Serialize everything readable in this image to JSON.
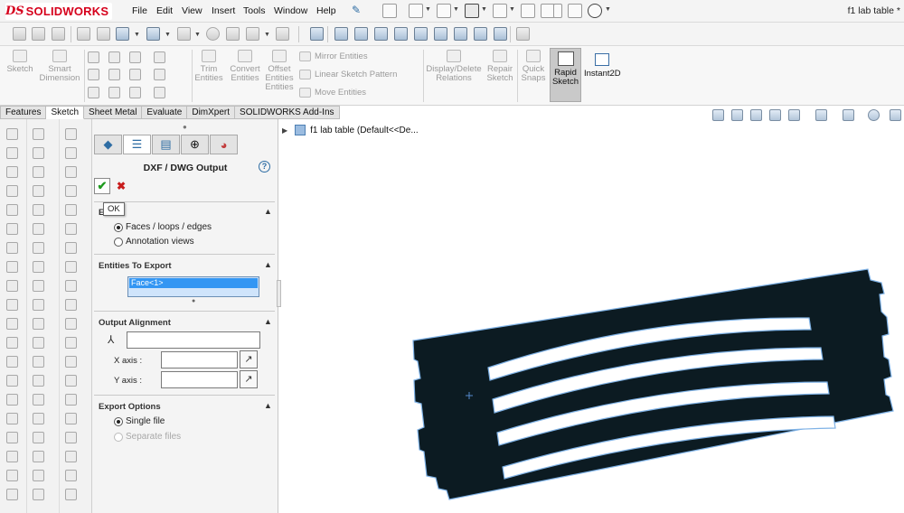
{
  "app": {
    "logo_mark": "DS",
    "logo_text": "SOLIDWORKS",
    "document_title": "f1 lab table *"
  },
  "menu": {
    "items": [
      "File",
      "Edit",
      "View",
      "Insert",
      "Tools",
      "Window",
      "Help"
    ]
  },
  "tabs": {
    "items": [
      "Features",
      "Sketch",
      "Sheet Metal",
      "Evaluate",
      "DimXpert",
      "SOLIDWORKS Add-Ins"
    ],
    "active": "Sketch"
  },
  "command_manager": {
    "sketch": "Sketch",
    "smart_dimension_1": "Smart",
    "smart_dimension_2": "Dimension",
    "trim_1": "Trim",
    "trim_2": "Entities",
    "convert_1": "Convert",
    "convert_2": "Entities",
    "offset_1": "Offset",
    "offset_2": "Entities",
    "mirror": "Mirror Entities",
    "linear_pattern": "Linear Sketch Pattern",
    "move": "Move Entities",
    "display_delete_1": "Display/Delete",
    "display_delete_2": "Relations",
    "repair_1": "Repair",
    "repair_2": "Sketch",
    "quick_snaps_1": "Quick",
    "quick_snaps_2": "Snaps",
    "rapid_sketch_1": "Rapid",
    "rapid_sketch_2": "Sketch",
    "instant2d": "Instant2D"
  },
  "property_manager": {
    "title": "DXF / DWG Output",
    "help": "?",
    "ok_glyph": "✔",
    "cancel_glyph": "✖",
    "ok_tooltip": "OK",
    "export_section_head": "E",
    "export_options": [
      {
        "label": "Faces / loops / edges",
        "checked": true
      },
      {
        "label": "Annotation views",
        "checked": false
      }
    ],
    "entities_section_head": "Entities To Export",
    "entities_selected": "Face<1>",
    "alignment_section_head": "Output Alignment",
    "x_axis_label": "X axis :",
    "y_axis_label": "Y axis :",
    "export_options_head": "Export Options",
    "file_options": [
      {
        "label": "Single file",
        "checked": true,
        "enabled": true
      },
      {
        "label": "Separate files",
        "checked": false,
        "enabled": false
      }
    ]
  },
  "graphics": {
    "tree_root": "f1 lab table  (Default<<De...",
    "part_fill": "#0c1b22",
    "part_outline": "#7fb2e6",
    "slot_fill": "#ffffff"
  },
  "colors": {
    "accent": "#2e6da4",
    "selection": "#3396f3",
    "brand_red": "#d6001c"
  }
}
